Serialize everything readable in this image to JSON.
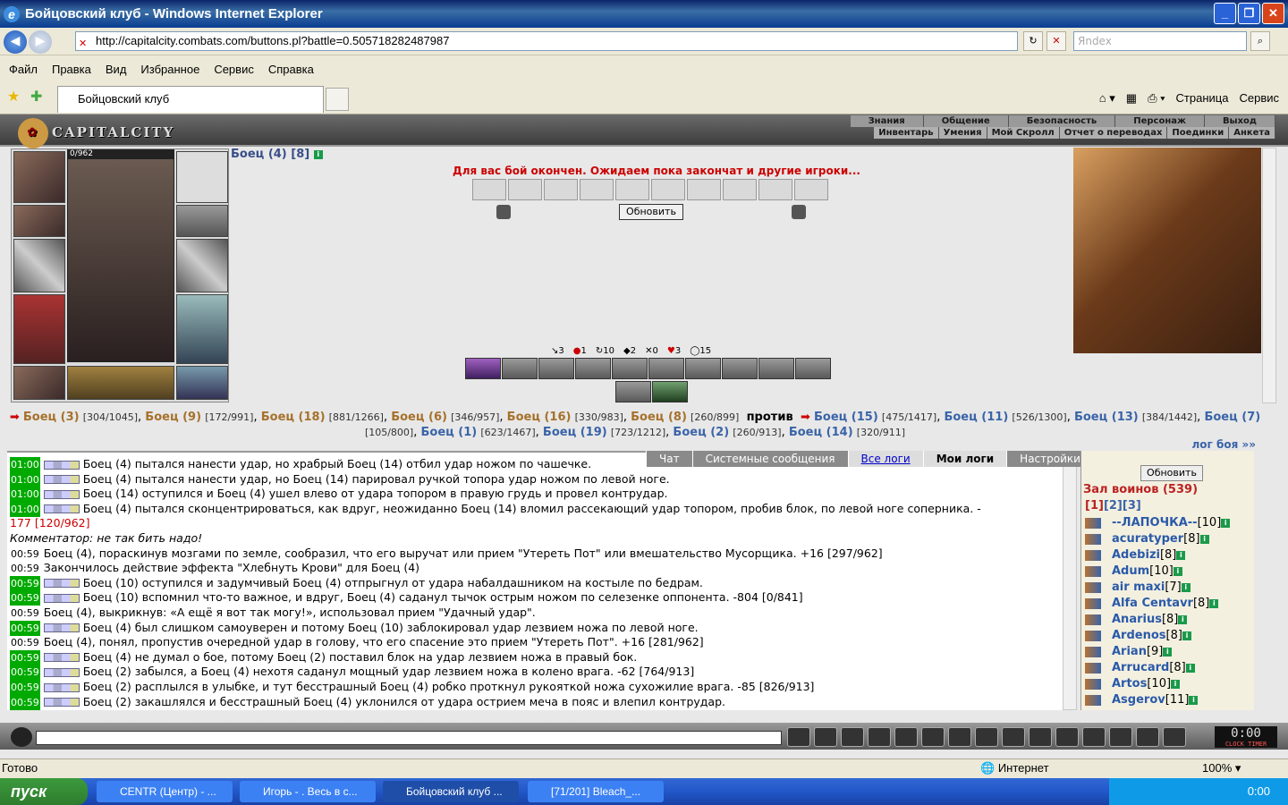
{
  "window": {
    "title": "Бойцовский клуб - Windows Internet Explorer"
  },
  "address": {
    "url": "http://capitalcity.combats.com/buttons.pl?battle=0.505718282487987",
    "search_placeholder": "Яndex"
  },
  "menu": [
    "Файл",
    "Правка",
    "Вид",
    "Избранное",
    "Сервис",
    "Справка"
  ],
  "tab": {
    "title": "Бойцовский клуб"
  },
  "tools": {
    "page": "Страница",
    "service": "Сервис"
  },
  "game": {
    "logo": "CAPITALCITY",
    "menu_top": [
      "Знания",
      "Общение",
      "Безопасность",
      "Персонаж",
      "Выход"
    ],
    "menu_bottom": [
      "Инвентарь",
      "Умения",
      "Мой Скролл",
      "Отчет о переводах",
      "Поединки",
      "Анкета"
    ],
    "hp": "0/962",
    "player": "Боец (4) [8]",
    "battle_msg": "Для вас бой окончен. Ожидаем пока закончат и другие игроки...",
    "refresh": "Обновить",
    "stats": [
      "3",
      "1",
      "10",
      "2",
      "0",
      "3",
      "15"
    ],
    "team1": [
      [
        "Боец (3)",
        "[304/1045]"
      ],
      [
        "Боец (9)",
        "[172/991]"
      ],
      [
        "Боец (18)",
        "[881/1266]"
      ],
      [
        "Боец (6)",
        "[346/957]"
      ],
      [
        "Боец (16)",
        "[330/983]"
      ],
      [
        "Боец (8)",
        "[260/899]"
      ]
    ],
    "vs": "против",
    "team2": [
      [
        "Боец (15)",
        "[475/1417]"
      ],
      [
        "Боец (11)",
        "[526/1300]"
      ],
      [
        "Боец (13)",
        "[384/1442]"
      ],
      [
        "Боец (7)",
        "[105/800]"
      ],
      [
        "Боец (1)",
        "[623/1467]"
      ],
      [
        "Боец (19)",
        "[723/1212]"
      ],
      [
        "Боец (2)",
        "[260/913]"
      ],
      [
        "Боец (14)",
        "[320/911]"
      ]
    ],
    "log_link": "лог боя »»"
  },
  "logtabs": [
    "Чат",
    "Системные сообщения",
    "Все логи",
    "Мои логи",
    "Настройки"
  ],
  "log": [
    {
      "t": "01:00",
      "g": true,
      "text": "Боец (4) пытался нанести удар, но храбрый Боец (14) отбил удар ножом по чашечке."
    },
    {
      "t": "01:00",
      "g": true,
      "text": "Боец (4) пытался нанести удар, но Боец (14) парировал ручкой топора удар ножом по левой ноге."
    },
    {
      "t": "01:00",
      "g": true,
      "text": "Боец (14) оступился и Боец (4) ушел влево от удара топором в правую грудь и провел контрудар."
    },
    {
      "t": "01:00",
      "g": true,
      "text": "Боец (4) пытался сконцентрироваться, как вдруг, неожиданно Боец (14) вломил рассекающий удар топором, пробив блок, по левой ноге соперника. -"
    },
    {
      "t": "",
      "g": false,
      "text": "177 [120/962]"
    },
    {
      "t": "",
      "g": false,
      "text": "Комментатор: не так бить надо!"
    },
    {
      "t": "00:59",
      "g": false,
      "text": "Боец (4), пораскинув мозгами по земле, сообразил, что его выручат или прием \"Утереть Пот\" или вмешательство Мусорщика. +16 [297/962]"
    },
    {
      "t": "00:59",
      "g": false,
      "text": "Закончилось действие эффекта \"Хлебнуть Крови\" для Боец (4)"
    },
    {
      "t": "00:59",
      "g": true,
      "text": "Боец (10) оступился и задумчивый Боец (4) отпрыгнул от удара набалдашником на костыле по бедрам."
    },
    {
      "t": "00:59",
      "g": true,
      "text": "Боец (10) вспомнил что-то важное, и вдруг, Боец (4) саданул тычок острым ножом по селезенке оппонента. -804 [0/841]"
    },
    {
      "t": "00:59",
      "g": false,
      "text": "Боец (4), выкрикнув: «А ещё я вот так могу!», использовал прием \"Удачный удар\"."
    },
    {
      "t": "00:59",
      "g": true,
      "text": "Боец (4) был слишком самоуверен и потому Боец (10) заблокировал удар лезвием ножа по левой ноге."
    },
    {
      "t": "00:59",
      "g": false,
      "text": "Боец (4), понял, пропустив очередной удар в голову, что его спасение это прием \"Утереть Пот\". +16 [281/962]"
    },
    {
      "t": "00:59",
      "g": true,
      "text": "Боец (4) не думал о бое, потому Боец (2) поставил блок на удар лезвием ножа в правый бок."
    },
    {
      "t": "00:59",
      "g": true,
      "text": "Боец (2) забылся, а Боец (4) нехотя саданул мощный удар лезвием ножа в колено врага. -62 [764/913]"
    },
    {
      "t": "00:59",
      "g": true,
      "text": "Боец (2) расплылся в улыбке, и тут бесстрашный Боец (4) робко проткнул рукояткой ножа сухожилие врага. -85 [826/913]"
    },
    {
      "t": "00:59",
      "g": true,
      "text": "Боец (2) закашлялся и бесстрашный Боец (4) уклонился от удара острием меча в пояс и влепил контрудар."
    }
  ],
  "side": {
    "refresh": "Обновить",
    "hall": "Зал воинов (539)",
    "pages": [
      "[1]",
      "[2]",
      "[3]"
    ],
    "users": [
      [
        "--ЛАПОЧКА--",
        "[10]"
      ],
      [
        "acuratyper",
        "[8]"
      ],
      [
        "Adebizi",
        "[8]"
      ],
      [
        "Adum",
        "[10]"
      ],
      [
        "air maxi",
        "[7]"
      ],
      [
        "Alfa Centavr",
        "[8]"
      ],
      [
        "Anarius",
        "[8]"
      ],
      [
        "Ardenos",
        "[8]"
      ],
      [
        "Arian",
        "[9]"
      ],
      [
        "Arrucard",
        "[8]"
      ],
      [
        "Artos",
        "[10]"
      ],
      [
        "Asgerov",
        "[11]"
      ]
    ]
  },
  "clock": {
    "time": "0:00",
    "label": "CLOCK TIMER"
  },
  "status": {
    "ready": "Готово",
    "zone": "Интернет",
    "zoom": "100%"
  },
  "taskbar": {
    "start": "пуск",
    "tasks": [
      "CENTR (Центр) - ...",
      "Игорь - . Весь в с...",
      "Бойцовский клуб ...",
      "[71/201] Bleach_..."
    ],
    "time": "0:00"
  }
}
